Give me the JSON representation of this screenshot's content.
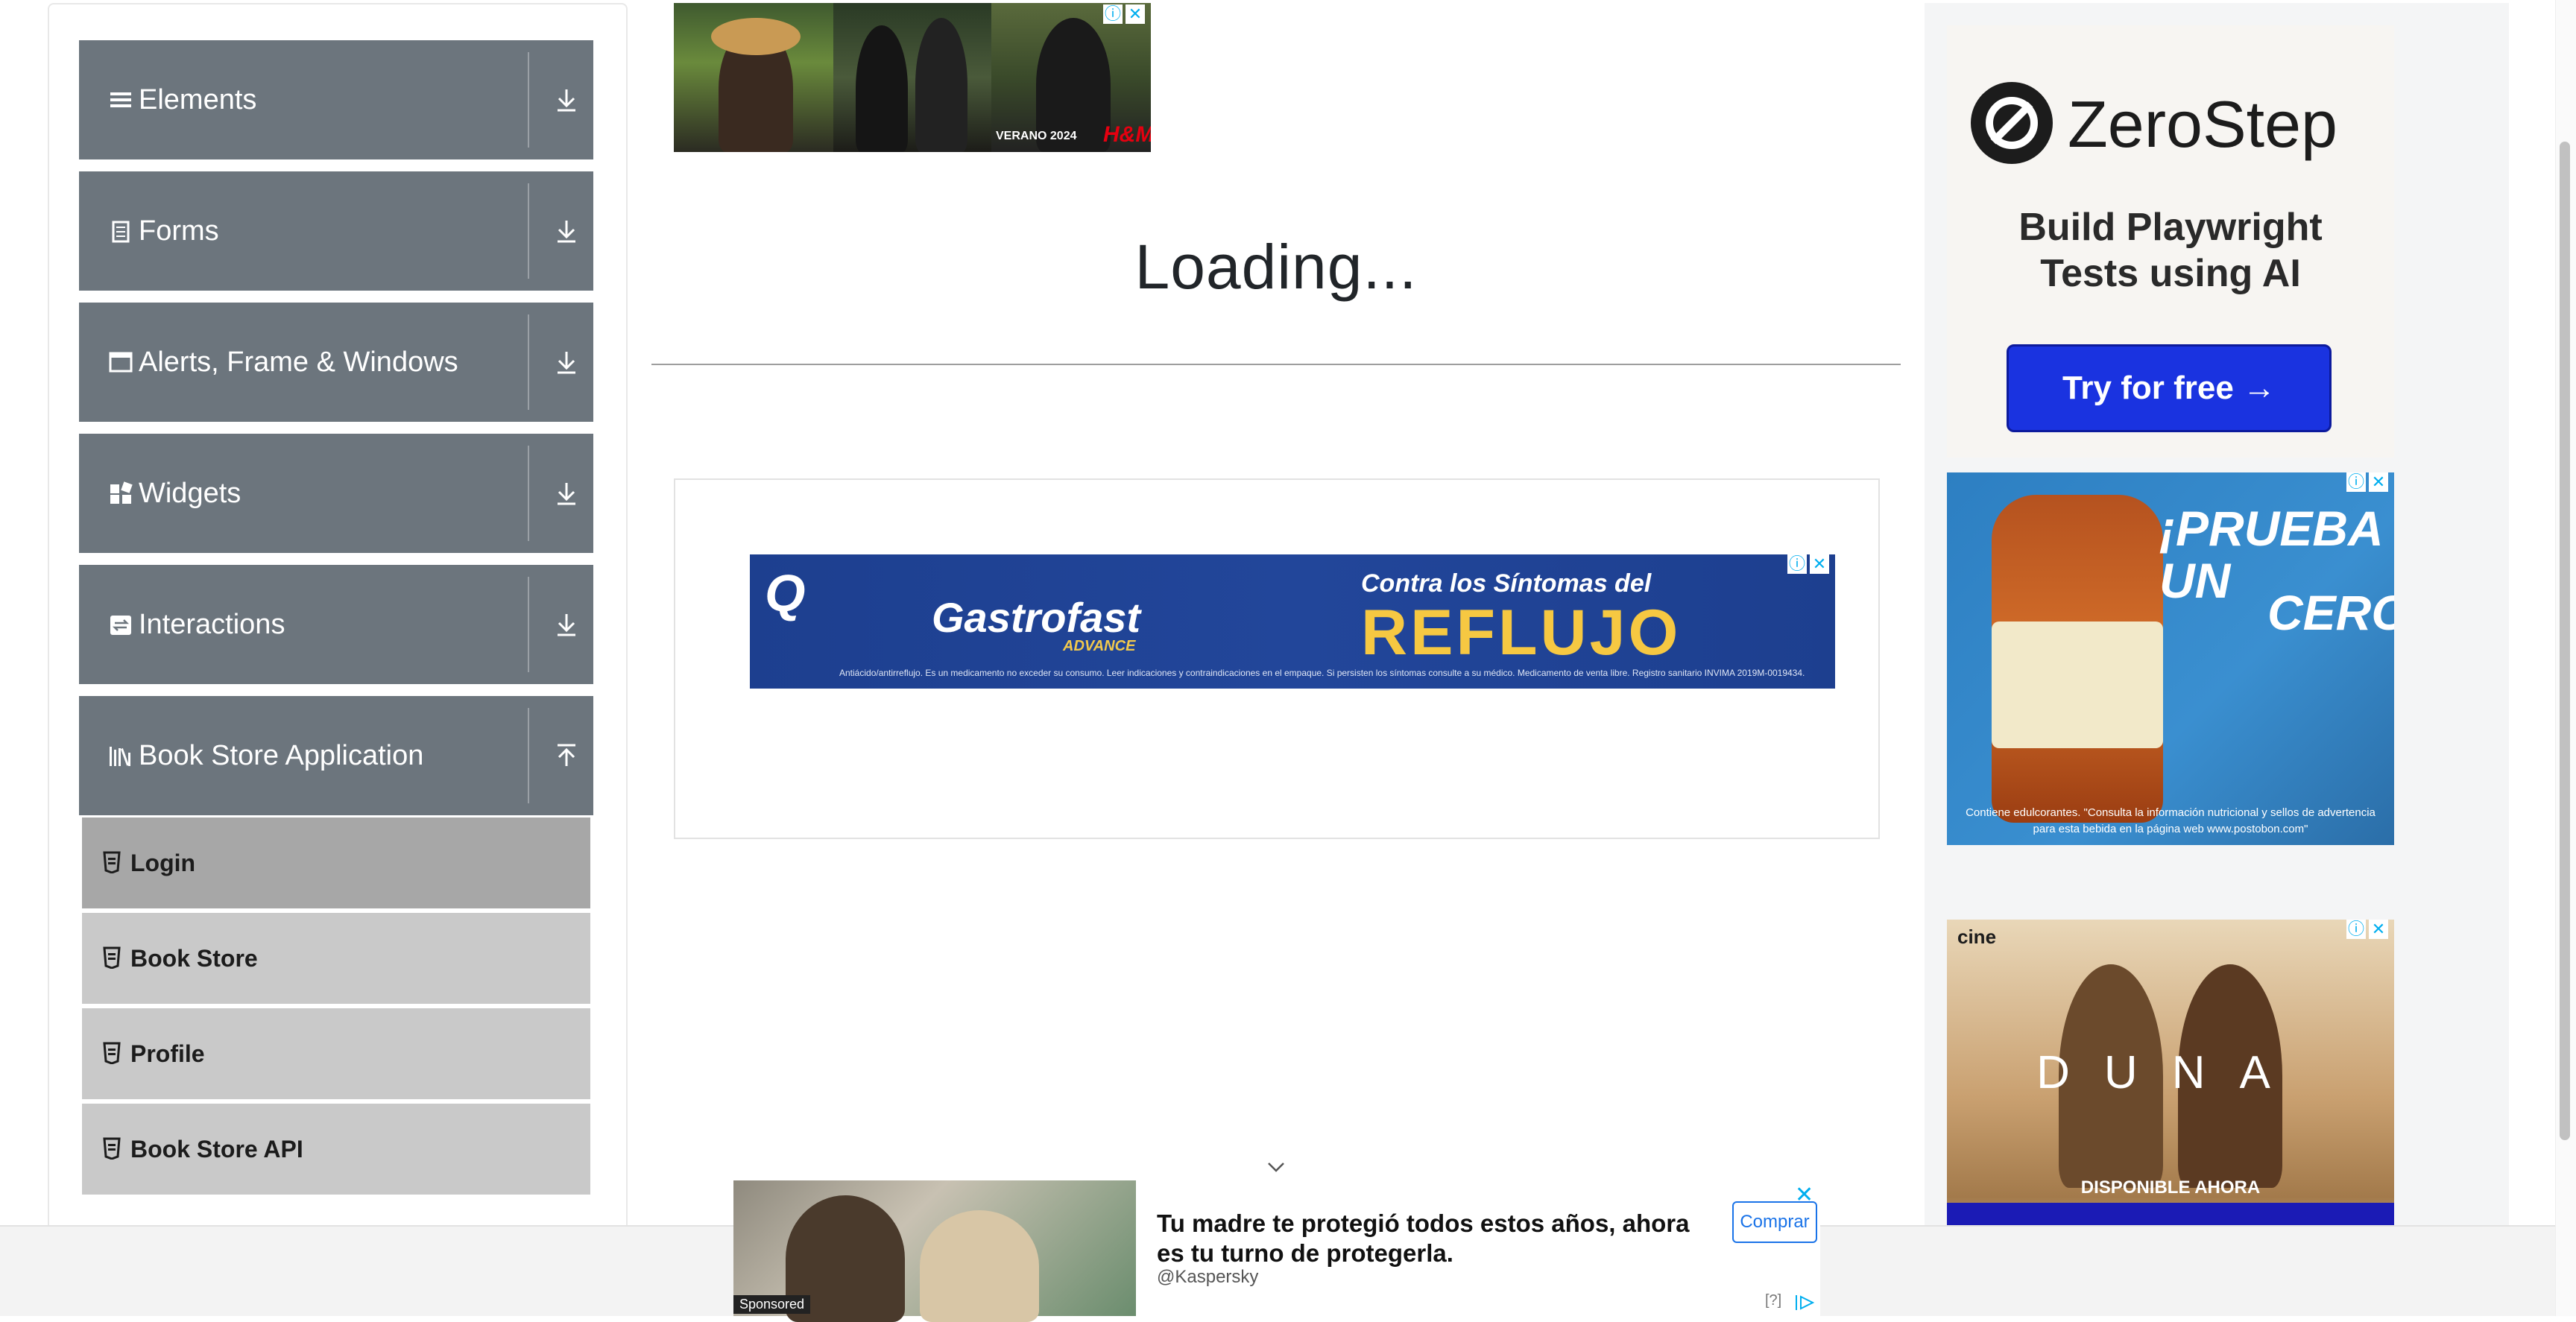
{
  "sidebar": {
    "groups": [
      {
        "label": "Elements",
        "icon": "hamburger-icon"
      },
      {
        "label": "Forms",
        "icon": "form-icon"
      },
      {
        "label": "Alerts, Frame & Windows",
        "icon": "window-icon"
      },
      {
        "label": "Widgets",
        "icon": "widgets-icon"
      },
      {
        "label": "Interactions",
        "icon": "interactions-icon"
      },
      {
        "label": "Book Store Application",
        "icon": "books-icon"
      }
    ],
    "items": [
      {
        "label": "Login",
        "active": true
      },
      {
        "label": "Book Store",
        "active": false
      },
      {
        "label": "Profile",
        "active": false
      },
      {
        "label": "Book Store API",
        "active": false
      }
    ]
  },
  "main": {
    "title": "Loading..."
  },
  "ads": {
    "top": {
      "caption": "VERANO 2024",
      "brand": "H&M"
    },
    "banner": {
      "brand": "Gastrofast",
      "brand_sub": "ADVANCE",
      "tagline": "Contra los Síntomas del",
      "headline": "REFLUJO",
      "fine_print": "Antiácido/antirreflujo. Es un medicamento no exceder su consumo. Leer indicaciones y contraindicaciones en el empaque. Si persisten los síntomas consulte a su médico. Medicamento de venta libre. Registro sanitario INVIMA 2019M-0019434."
    },
    "zerostep": {
      "name": "ZeroStep",
      "tagline_line1": "Build Playwright",
      "tagline_line2": "Tests using AI",
      "cta": "Try for free →"
    },
    "tea": {
      "headline_line1": "¡PRUEBA UN",
      "headline_line2": "CERO",
      "fine_print": "Contiene edulcorantes. \"Consulta la información nutricional y sellos de advertencia para esta bebida en la página web www.postobon.com\""
    },
    "dune": {
      "cine": "cine",
      "title": "DUNA",
      "availability": "DISPONIBLE AHORA"
    },
    "sponsored": {
      "tag": "Sponsored",
      "headline": "Tu madre te protegió todos estos años, ahora es tu turno de protegerla.",
      "advertiser": "@Kaspersky",
      "cta": "Comprar",
      "help": "[?]"
    }
  },
  "colors": {
    "group_bg": "#6c757d",
    "item_bg": "#c9c9c9",
    "item_active_bg": "#a7a7a7",
    "cta_blue": "#1a33e0"
  }
}
